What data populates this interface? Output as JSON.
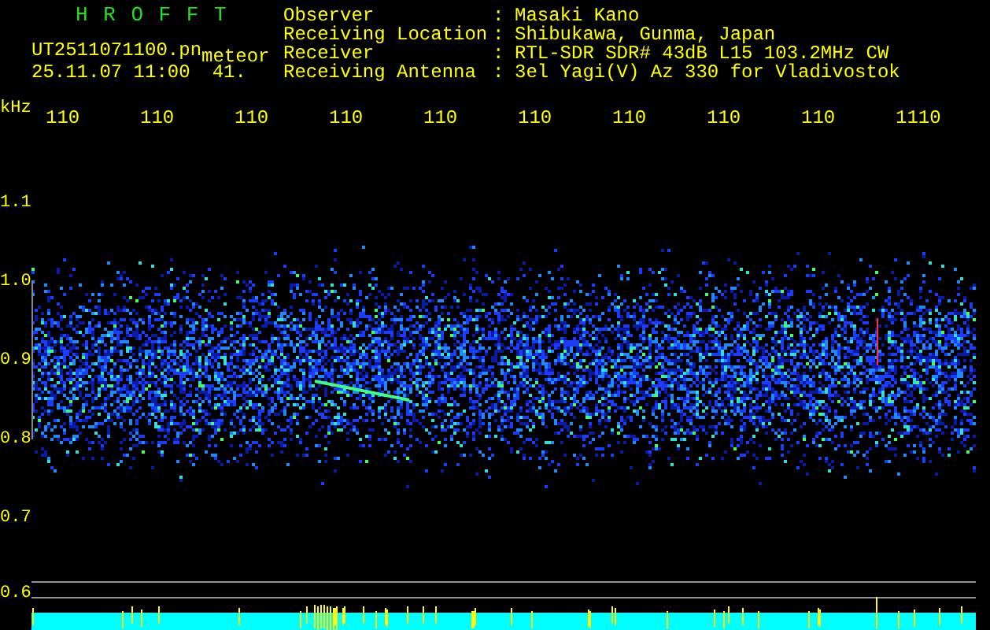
{
  "header": {
    "title": "H R O F F T",
    "file": "UT2511071100.pn",
    "tag": "meteor",
    "datetime": "25.11.07 11:00",
    "value": "41."
  },
  "info": [
    {
      "label": "Observer",
      "separator": ":",
      "value": "Masaki Kano"
    },
    {
      "label": "Receiving Location",
      "separator": ":",
      "value": "Shibukawa, Gunma, Japan"
    },
    {
      "label": "Receiver",
      "separator": ":",
      "value": "RTL-SDR SDR# 43dB L15 103.2MHz CW"
    },
    {
      "label": "Receiving Antenna",
      "separator": ":",
      "value": "3el Yagi(V) Az 330 for Vladivostok"
    }
  ],
  "time_labels": [
    "110",
    "110",
    "110",
    "110",
    "110",
    "110",
    "110",
    "110",
    "110",
    "1110"
  ],
  "freq_axis": {
    "unit": "kHz",
    "labels": [
      "1.1",
      "1.0",
      "0.9",
      "0.8",
      "0.7",
      "0.6"
    ]
  }
}
